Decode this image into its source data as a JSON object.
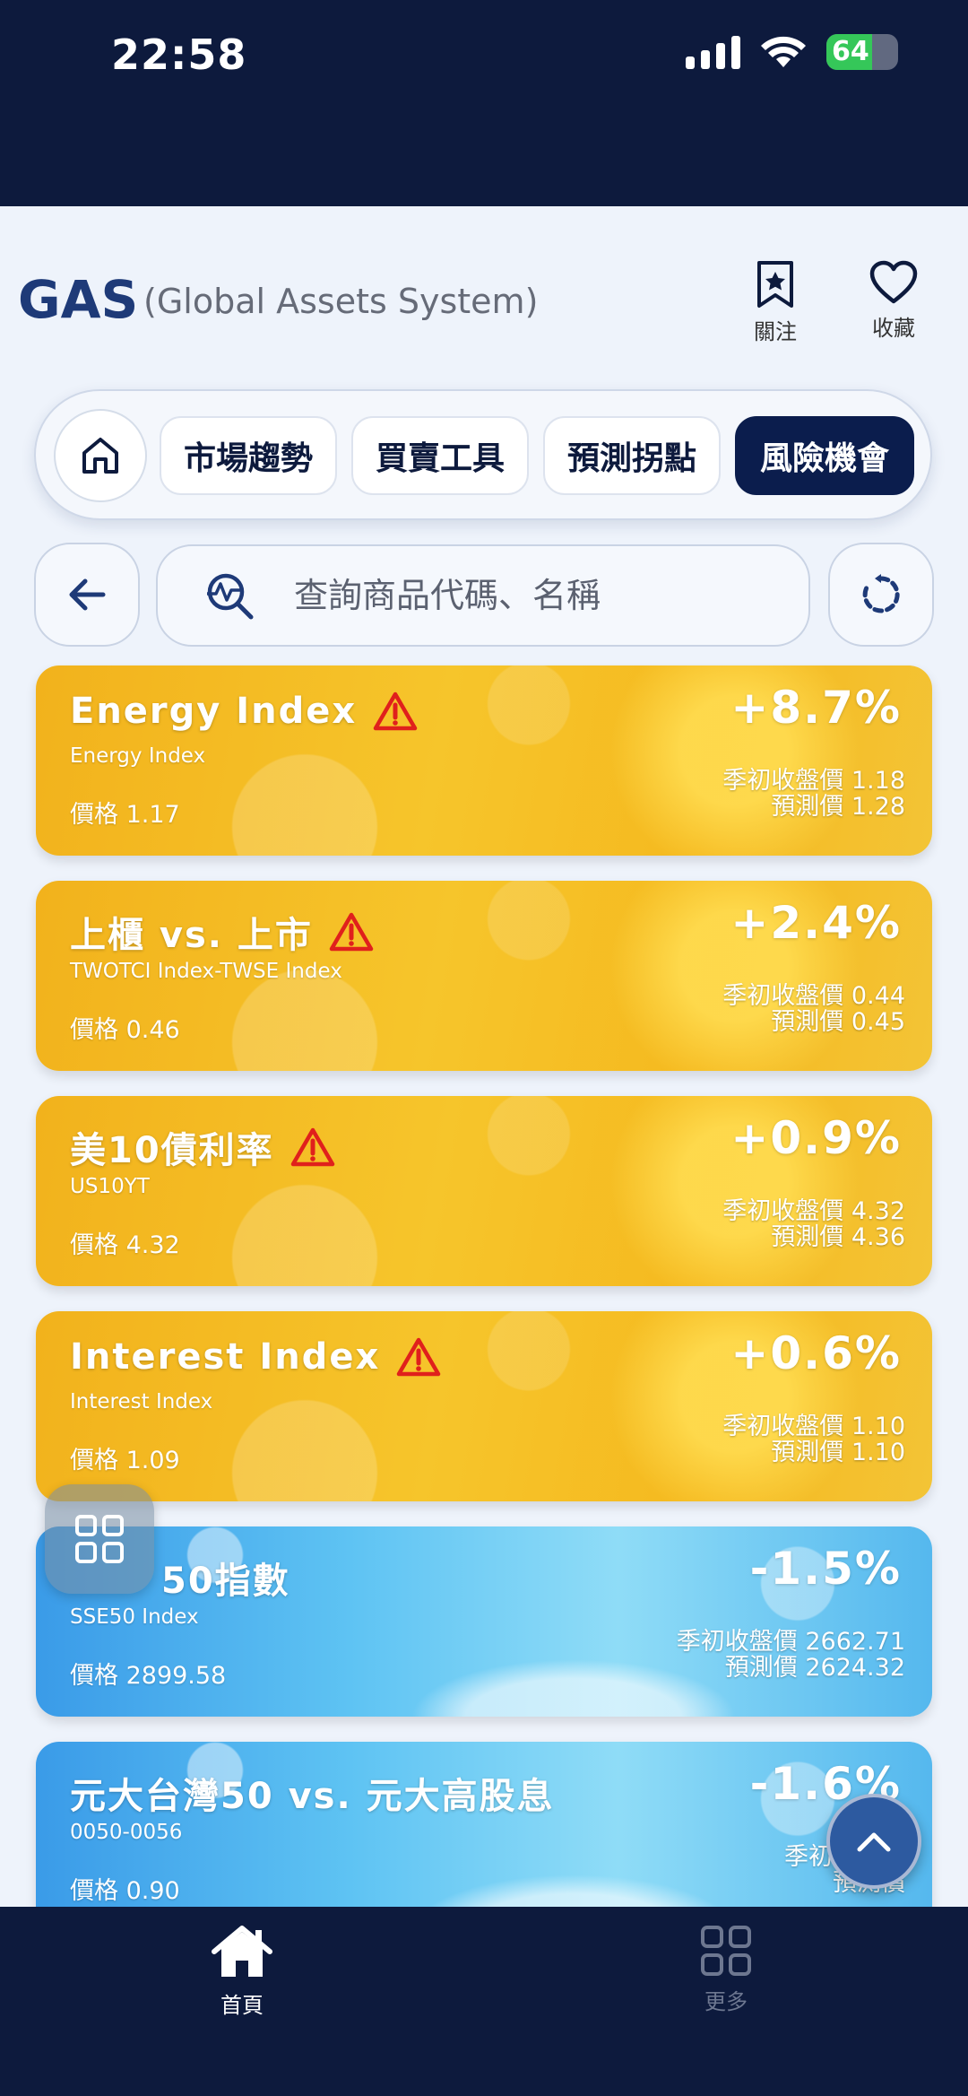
{
  "status": {
    "time": "22:58",
    "battery": "64",
    "battery_level": 0.64
  },
  "header": {
    "logo": "GAS",
    "subtitle": "(Global Assets System)",
    "follow_label": "關注",
    "favorite_label": "收藏"
  },
  "tabs": [
    {
      "label": "市場趨勢",
      "active": false
    },
    {
      "label": "買賣工具",
      "active": false
    },
    {
      "label": "預測拐點",
      "active": false
    },
    {
      "label": "風險機會",
      "active": true
    }
  ],
  "search": {
    "placeholder": "查詢商品代碼、名稱"
  },
  "cards": [
    {
      "title": "Energy Index",
      "warning": true,
      "code": "Energy Index",
      "price": "價格 1.17",
      "change": "+8.7%",
      "season_close": "季初收盤價 1.18",
      "forecast": "預測價 1.28",
      "theme": "sun"
    },
    {
      "title": "上櫃 vs. 上市",
      "warning": true,
      "code": "TWOTCI Index-TWSE Index",
      "price": "價格 0.46",
      "change": "+2.4%",
      "season_close": "季初收盤價 0.44",
      "forecast": "預測價 0.45",
      "theme": "sun"
    },
    {
      "title": "美10債利率",
      "warning": true,
      "code": "US10YT",
      "price": "價格 4.32",
      "change": "+0.9%",
      "season_close": "季初收盤價 4.32",
      "forecast": "預測價 4.36",
      "theme": "sun"
    },
    {
      "title": "Interest Index",
      "warning": true,
      "code": "Interest Index",
      "price": "價格 1.09",
      "change": "+0.6%",
      "season_close": "季初收盤價 1.10",
      "forecast": "預測價 1.10",
      "theme": "sun"
    },
    {
      "title": "50指數",
      "warning": false,
      "code": "SSE50 Index",
      "price": "價格 2899.58",
      "change": "-1.5%",
      "season_close": "季初收盤價 2662.71",
      "forecast": "預測價 2624.32",
      "theme": "ice"
    },
    {
      "title": "元大台灣50 vs. 元大高股息",
      "warning": false,
      "code": "0050-0056",
      "price": "價格 0.90",
      "change": "-1.6%",
      "season_close": "季初收盤價",
      "forecast": "預測價",
      "theme": "ice"
    }
  ],
  "bottom_nav": {
    "home_label": "首頁",
    "more_label": "更多"
  },
  "colors": {
    "navy": "#0d1a3d",
    "accent": "#0b1d4d",
    "warning": "#e0201c"
  },
  "icons": [
    "home-icon",
    "bookmark-star-icon",
    "heart-icon",
    "back-arrow-icon",
    "search-chart-icon",
    "refresh-icon",
    "warning-icon",
    "grid-icon",
    "chevron-up-icon"
  ]
}
